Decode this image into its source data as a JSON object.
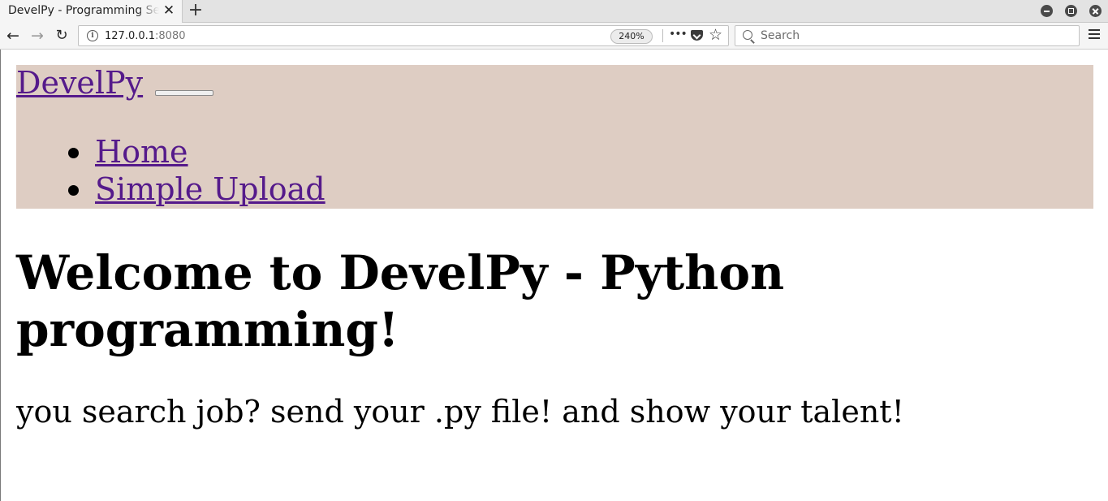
{
  "browser": {
    "tab_title": "DevelPy - Programming Services",
    "url_host": "127.0.0.1",
    "url_port": ":8080",
    "zoom": "240%",
    "search_placeholder": "Search"
  },
  "site": {
    "brand": "DevelPy",
    "nav_items": [
      {
        "label": "Home"
      },
      {
        "label": "Simple Upload"
      }
    ],
    "nav_background": "#decdc3",
    "link_color": "#551a8b"
  },
  "main": {
    "heading": "Welcome to DevelPy - Python programming!",
    "tagline": "you search job? send your .py file! and show your talent!"
  }
}
